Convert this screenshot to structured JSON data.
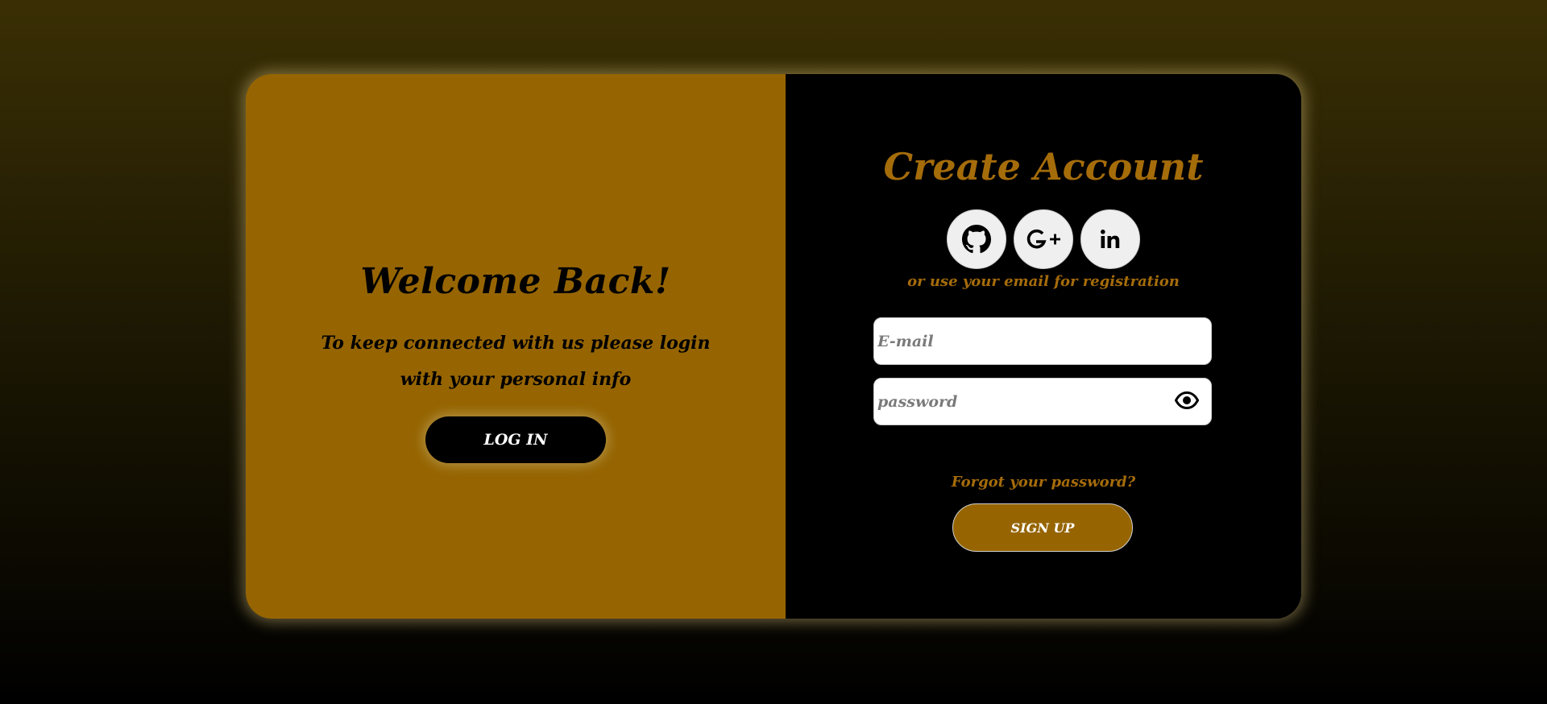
{
  "left_panel": {
    "title": "Welcome Back!",
    "message": "To keep connected with us please login with your personal info",
    "login_label": "LOG IN"
  },
  "right_panel": {
    "title": "Create Account",
    "social": [
      {
        "name": "github",
        "icon": "github-icon"
      },
      {
        "name": "google-plus",
        "icon": "google-plus-icon"
      },
      {
        "name": "linkedin",
        "icon": "linkedin-icon"
      }
    ],
    "alt_text": "or use your email for registration",
    "email_placeholder": "E-mail",
    "password_placeholder": "password",
    "password_toggle_icon": "eye-icon",
    "forgot_label": "Forgot your password?",
    "signup_label": "SIGN UP"
  },
  "colors": {
    "accent": "#966502",
    "accent_text": "#a56c0a",
    "dark_panel": "#000000"
  }
}
